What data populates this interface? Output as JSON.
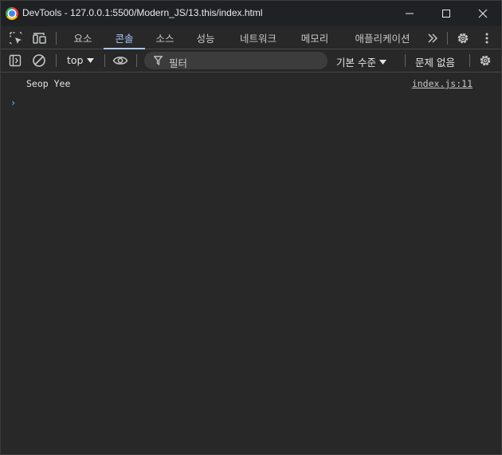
{
  "window": {
    "title": "DevTools - 127.0.0.1:5500/Modern_JS/13.this/index.html",
    "icons": {
      "app": "chrome-icon",
      "minimize": "minimize-icon",
      "maximize": "maximize-icon",
      "close": "close-icon"
    }
  },
  "tabbar": {
    "icons": {
      "inspect": "inspect-element-icon",
      "device": "device-toggle-icon",
      "more_tabs": "chevron-double-right-icon",
      "settings": "gear-icon",
      "menu": "kebab-menu-icon"
    },
    "tabs": [
      {
        "label": "요소"
      },
      {
        "label": "콘솔"
      },
      {
        "label": "소스"
      },
      {
        "label": "성능"
      },
      {
        "label": "네트워크"
      },
      {
        "label": "메모리"
      },
      {
        "label": "애플리케이션"
      }
    ],
    "active_tab": "콘솔"
  },
  "console_toolbar": {
    "icons": {
      "sidebar": "sidebar-toggle-icon",
      "clear": "clear-console-icon",
      "live_expression": "eye-icon",
      "filter": "filter-icon",
      "settings": "gear-icon"
    },
    "context": "top",
    "filter_placeholder": "필터",
    "levels": "기본 수준",
    "issues": "문제 없음"
  },
  "console": {
    "messages": [
      {
        "text": "Seop Yee",
        "source": "index.js:11"
      }
    ],
    "prompt": "›"
  },
  "colors": {
    "accent": "#a8c7fa",
    "background": "#282828",
    "titlebar": "#202124",
    "prompt": "#7cacf8"
  }
}
